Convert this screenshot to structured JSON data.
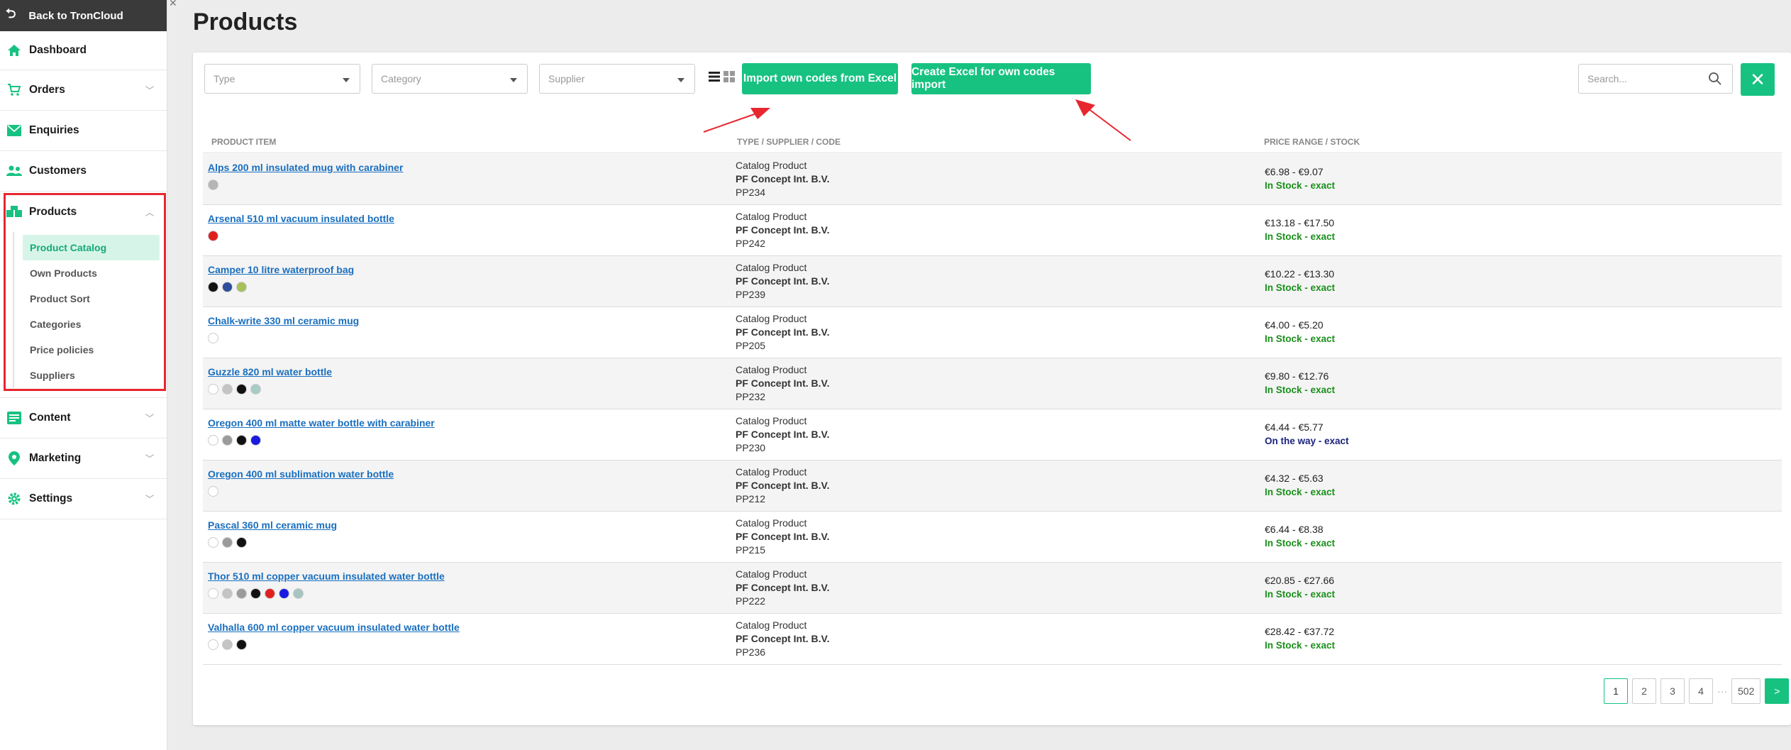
{
  "sidebar": {
    "back_label": "Back to TronCloud",
    "items": [
      {
        "label": "Dashboard",
        "icon": "home-icon"
      },
      {
        "label": "Orders",
        "icon": "cart-icon"
      },
      {
        "label": "Enquiries",
        "icon": "envelope-icon"
      },
      {
        "label": "Customers",
        "icon": "users-icon"
      },
      {
        "label": "Products",
        "icon": "boxes-icon"
      },
      {
        "label": "Content",
        "icon": "content-icon"
      },
      {
        "label": "Marketing",
        "icon": "location-icon"
      },
      {
        "label": "Settings",
        "icon": "gear-icon"
      }
    ],
    "products_sub": [
      "Product Catalog",
      "Own Products",
      "Product Sort",
      "Categories",
      "Price policies",
      "Suppliers"
    ],
    "active_sub": "Product Catalog"
  },
  "page": {
    "title": "Products"
  },
  "filters": {
    "type_placeholder": "Type",
    "category_placeholder": "Category",
    "supplier_placeholder": "Supplier",
    "search_placeholder": "Search..."
  },
  "toolbar": {
    "import_label": "Import own codes from Excel",
    "create_label": "Create Excel for own codes import",
    "close_label": "✕"
  },
  "table": {
    "headers": {
      "product": "PRODUCT ITEM",
      "type": "TYPE / SUPPLIER / CODE",
      "price": "PRICE RANGE / STOCK"
    },
    "rows": [
      {
        "name": "Alps 200 ml insulated mug with carabiner",
        "colors": [
          "#b5b5b5"
        ],
        "type": "Catalog Product",
        "supplier": "PF Concept Int. B.V.",
        "code": "PP234",
        "price": "€6.98 - €9.07",
        "stock": "In Stock - exact",
        "stock_status": "instock"
      },
      {
        "name": "Arsenal 510 ml vacuum insulated bottle",
        "colors": [
          "#e02020"
        ],
        "type": "Catalog Product",
        "supplier": "PF Concept Int. B.V.",
        "code": "PP242",
        "price": "€13.18 - €17.50",
        "stock": "In Stock - exact",
        "stock_status": "instock"
      },
      {
        "name": "Camper 10 litre waterproof bag",
        "colors": [
          "#111111",
          "#2e4d9b",
          "#a6c05a"
        ],
        "type": "Catalog Product",
        "supplier": "PF Concept Int. B.V.",
        "code": "PP239",
        "price": "€10.22 - €13.30",
        "stock": "In Stock - exact",
        "stock_status": "instock"
      },
      {
        "name": "Chalk-write 330 ml ceramic mug",
        "colors": [
          "#ffffff"
        ],
        "type": "Catalog Product",
        "supplier": "PF Concept Int. B.V.",
        "code": "PP205",
        "price": "€4.00 - €5.20",
        "stock": "In Stock - exact",
        "stock_status": "instock"
      },
      {
        "name": "Guzzle 820 ml water bottle",
        "colors": [
          "#ffffff",
          "#c4c4c4",
          "#111111",
          "#a8cbc4"
        ],
        "type": "Catalog Product",
        "supplier": "PF Concept Int. B.V.",
        "code": "PP232",
        "price": "€9.80 - €12.76",
        "stock": "In Stock - exact",
        "stock_status": "instock"
      },
      {
        "name": "Oregon 400 ml matte water bottle with carabiner",
        "colors": [
          "#ffffff",
          "#9b9b9b",
          "#111111",
          "#1a1ae0"
        ],
        "type": "Catalog Product",
        "supplier": "PF Concept Int. B.V.",
        "code": "PP230",
        "price": "€4.44 - €5.77",
        "stock": "On the way - exact",
        "stock_status": "ontheway"
      },
      {
        "name": "Oregon 400 ml sublimation water bottle",
        "colors": [
          "#ffffff"
        ],
        "type": "Catalog Product",
        "supplier": "PF Concept Int. B.V.",
        "code": "PP212",
        "price": "€4.32 - €5.63",
        "stock": "In Stock - exact",
        "stock_status": "instock"
      },
      {
        "name": "Pascal 360 ml ceramic mug",
        "colors": [
          "#ffffff",
          "#9b9b9b",
          "#111111"
        ],
        "type": "Catalog Product",
        "supplier": "PF Concept Int. B.V.",
        "code": "PP215",
        "price": "€6.44 - €8.38",
        "stock": "In Stock - exact",
        "stock_status": "instock"
      },
      {
        "name": "Thor 510 ml copper vacuum insulated water bottle",
        "colors": [
          "#ffffff",
          "#c4c4c4",
          "#9b9b9b",
          "#111111",
          "#e02020",
          "#1a1ae0",
          "#a8c4c0"
        ],
        "type": "Catalog Product",
        "supplier": "PF Concept Int. B.V.",
        "code": "PP222",
        "price": "€20.85 - €27.66",
        "stock": "In Stock - exact",
        "stock_status": "instock"
      },
      {
        "name": "Valhalla 600 ml copper vacuum insulated water bottle",
        "colors": [
          "#ffffff",
          "#c4c4c4",
          "#111111"
        ],
        "type": "Catalog Product",
        "supplier": "PF Concept Int. B.V.",
        "code": "PP236",
        "price": "€28.42 - €37.72",
        "stock": "In Stock - exact",
        "stock_status": "instock"
      }
    ]
  },
  "pagination": {
    "pages": [
      "1",
      "2",
      "3",
      "4"
    ],
    "ellipsis": "···",
    "last": "502",
    "next": ">",
    "current": "1"
  },
  "colors": {
    "accent": "#17c281",
    "highlight_red": "#e8262e",
    "link": "#1a6fbf"
  }
}
